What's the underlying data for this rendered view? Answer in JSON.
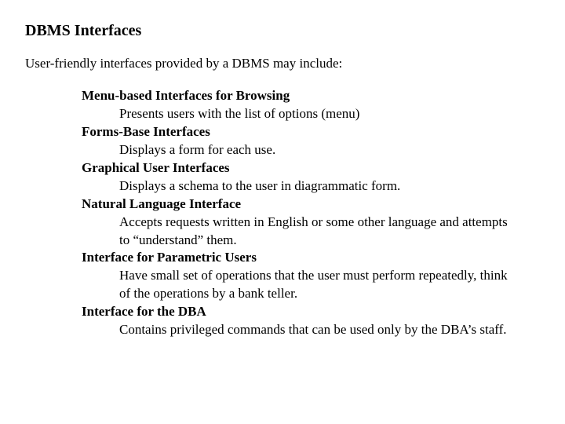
{
  "title": "DBMS Interfaces",
  "intro": "User-friendly interfaces provided by a DBMS may include:",
  "terms": [
    {
      "name": "Menu-based Interfaces for Browsing",
      "def": "Presents users with the list of options (menu)"
    },
    {
      "name": "Forms-Base Interfaces",
      "def": "Displays a form for each use."
    },
    {
      "name": "Graphical User Interfaces",
      "def": "Displays a schema to the user in diagrammatic form."
    },
    {
      "name": "Natural Language Interface",
      "def": "Accepts requests written in English or some other language and attempts to “understand” them."
    },
    {
      "name": "Interface for Parametric Users",
      "def": "Have small set of operations that the user must perform repeatedly, think of the operations by a bank teller."
    },
    {
      "name": "Interface for the DBA",
      "def": "Contains privileged commands that can be used only by the DBA’s staff."
    }
  ]
}
